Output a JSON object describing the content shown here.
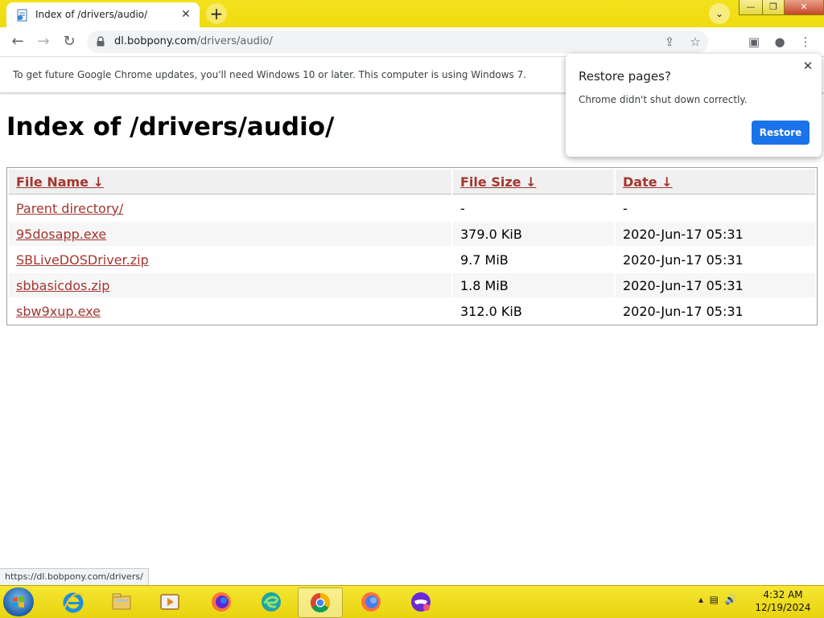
{
  "browser": {
    "tab_title": "Index of /drivers/audio/",
    "tab_close": "✕",
    "new_tab": "+",
    "tab_search": "⌄",
    "url_host": "dl.bobpony.com",
    "url_path": "/drivers/audio/",
    "window_controls": {
      "minimize": "—",
      "maximize": "❐",
      "close": "✕"
    }
  },
  "infobar": {
    "message": "To get future Google Chrome updates, you'll need Windows 10 or later. This computer is using Windows 7."
  },
  "popup": {
    "title": "Restore pages?",
    "message": "Chrome didn't shut down correctly.",
    "button": "Restore",
    "close": "✕",
    "accent": "#1a73e8"
  },
  "page": {
    "heading": "Index of /drivers/audio/",
    "columns": {
      "name": "File Name  ↓",
      "size": "File Size  ↓",
      "date": "Date  ↓"
    },
    "rows": [
      {
        "name": "Parent directory/",
        "size": "-",
        "date": "-"
      },
      {
        "name": "95dosapp.exe",
        "size": "379.0 KiB",
        "date": "2020-Jun-17 05:31"
      },
      {
        "name": "SBLiveDOSDriver.zip",
        "size": "9.7 MiB",
        "date": "2020-Jun-17 05:31"
      },
      {
        "name": "sbbasicdos.zip",
        "size": "1.8 MiB",
        "date": "2020-Jun-17 05:31"
      },
      {
        "name": "sbw9xup.exe",
        "size": "312.0 KiB",
        "date": "2020-Jun-17 05:31"
      }
    ],
    "link_color": "#a3362f"
  },
  "status_bar": {
    "url": "https://dl.bobpony.com/drivers/"
  },
  "taskbar": {
    "apps": [
      "internet-explorer",
      "file-explorer",
      "media-player",
      "firefox",
      "edge",
      "chrome",
      "firefox",
      "incognito-app"
    ],
    "time": "4:32 AM",
    "date": "12/19/2024",
    "theme_color": "#f0db10"
  }
}
